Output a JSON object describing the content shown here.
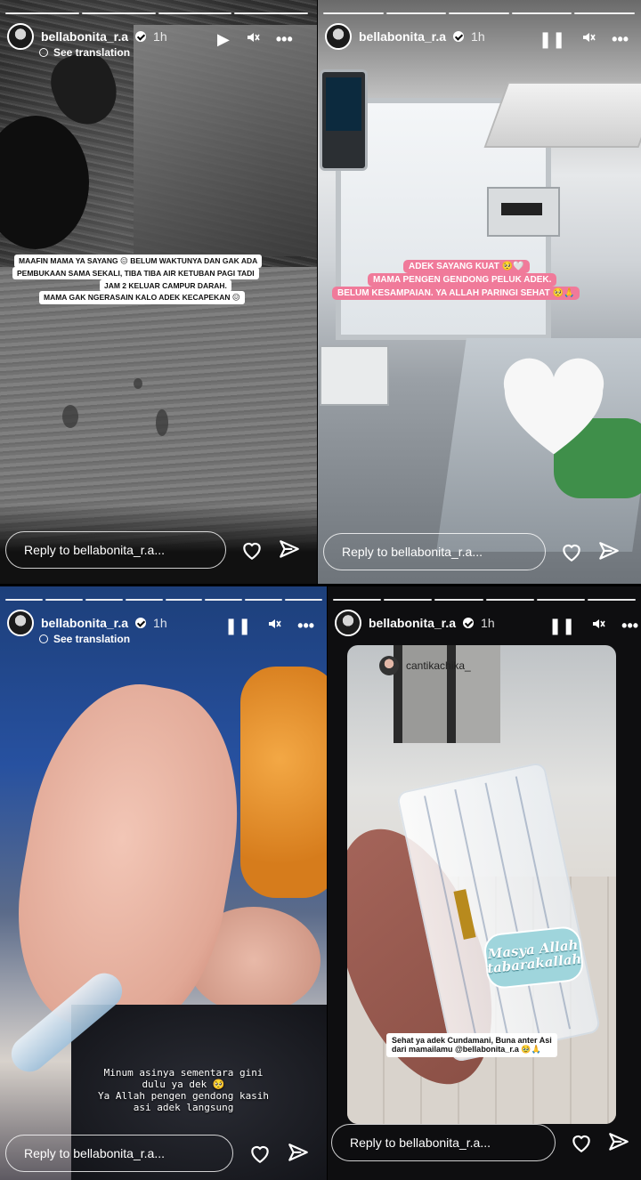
{
  "account": {
    "username": "bellabonita_r.a",
    "time": "1h"
  },
  "see_translation": "See translation",
  "reply_placeholders": {
    "s1": "Reply to bellabonita_r.a...",
    "s2": "Reply to bellabonita_r.a...",
    "s3": "Reply to bellabonita_r.a...",
    "s4": "Reply to bellabonita_r.a..."
  },
  "story1": {
    "caption_lines": [
      "MAAFIN MAMA YA SAYANG 😖 BELUM WAKTUNYA DAN GAK ADA",
      "PEMBUKAAN SAMA SEKALI, TIBA TIBA AIR KETUBAN PAGI TADI",
      "JAM 2 KELUAR CAMPUR DARAH.",
      "MAMA GAK NGERASAIN KALO ADEK KECAPEKAN 😖"
    ]
  },
  "story2": {
    "caption_lines": [
      "ADEK SAYANG KUAT 🥺🤍",
      "MAMA PENGEN GENDONG PELUK ADEK.",
      "BELUM KESAMPAIAN. YA ALLAH PARINGI SEHAT 🥺🙏"
    ]
  },
  "story3": {
    "caption": "Minum asinya sementara gini\ndulu ya dek 🥺\nYa Allah pengen gendong kasih\nasi adek langsung"
  },
  "story4": {
    "mention_user": "cantikachika_",
    "sticker_line1": "Masya Allah",
    "sticker_line2": "tabarakallah",
    "caption_line1": "Sehat ya adek Cundamani, Buna anter Asi",
    "caption_line2": "dari mamailamu @bellabonita_r.a 🥹🙏"
  },
  "icons": {
    "play": "play-icon",
    "pause": "pause-icon",
    "mute": "mute-icon",
    "more": "more-icon",
    "heart": "heart-icon",
    "send": "send-icon",
    "verified": "verified-badge-icon",
    "globe": "translate-icon"
  },
  "colors": {
    "caption_pink": "#f07a9a",
    "sticker_teal": "#9fd5dc"
  }
}
